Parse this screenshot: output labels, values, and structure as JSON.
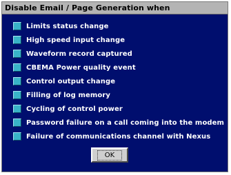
{
  "dialog": {
    "title": "Disable Email / Page Generation when",
    "options": [
      {
        "label": "Limits status change"
      },
      {
        "label": "High speed input change"
      },
      {
        "label": "Waveform record captured"
      },
      {
        "label": "CBEMA Power quality event"
      },
      {
        "label": "Control output change"
      },
      {
        "label": "Filling of log memory"
      },
      {
        "label": "Cycling of control power"
      },
      {
        "label": "Password failure on a call coming into the modem"
      },
      {
        "label": "Failure of communications channel with Nexus"
      }
    ],
    "ok_label": "OK"
  },
  "colors": {
    "dialog_background": "#000e6e",
    "titlebar_background": "#b4b4b4",
    "checkbox_fill": "#39b3c8",
    "button_face": "#cfcfcf"
  }
}
